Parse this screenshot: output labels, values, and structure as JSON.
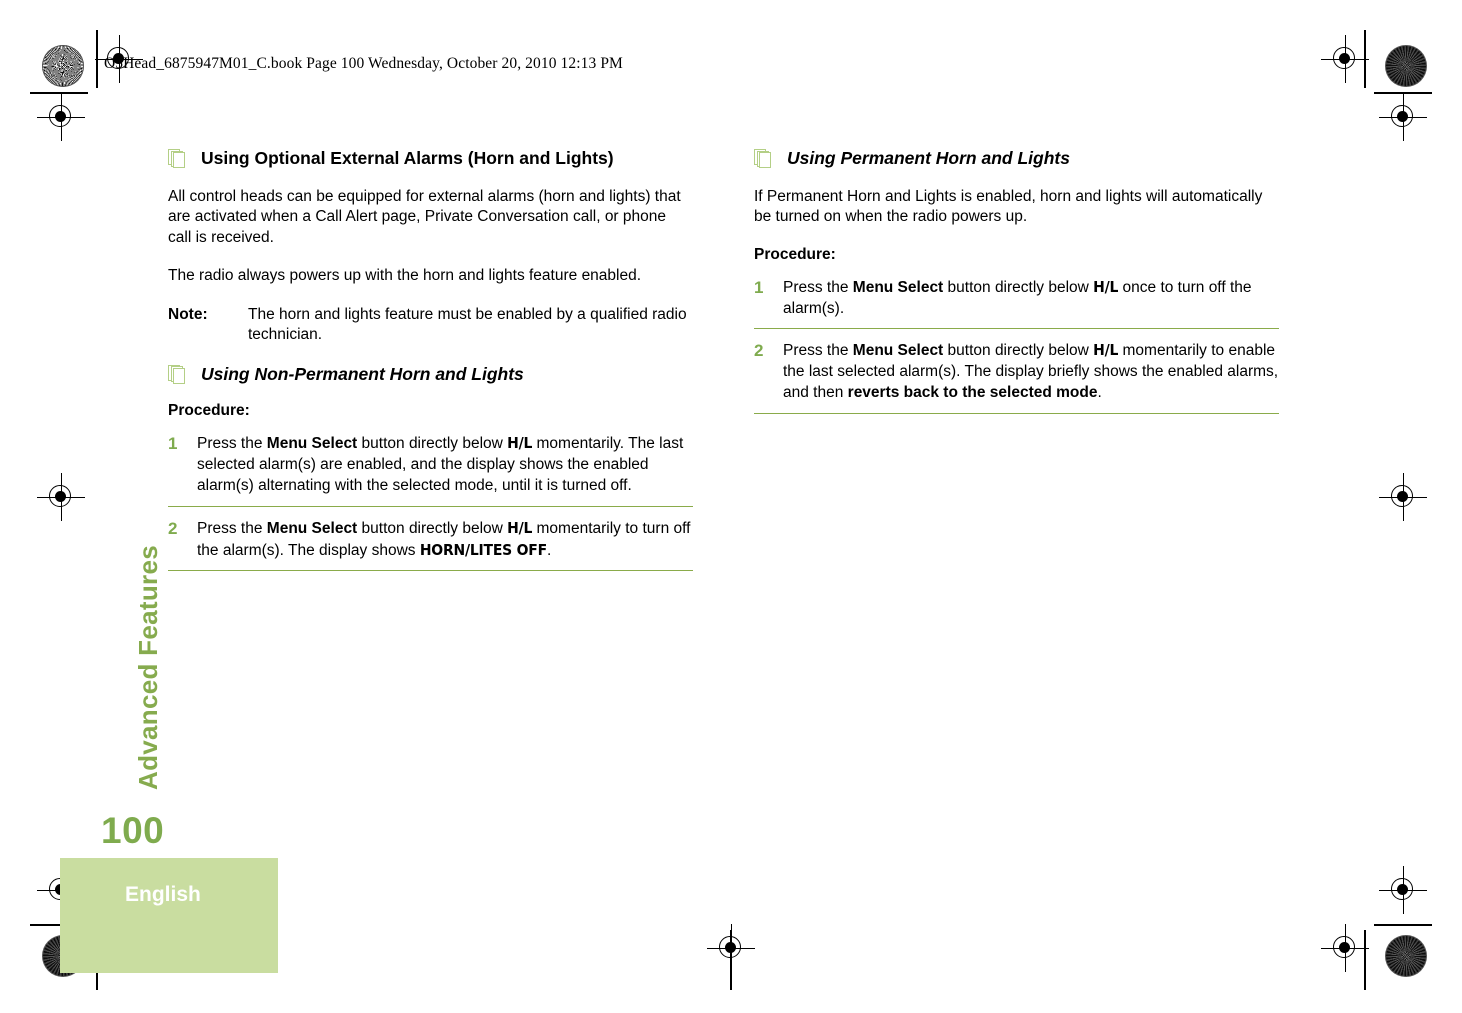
{
  "document": {
    "file_header": "O5Head_6875947M01_C.book  Page 100  Wednesday, October 20, 2010  12:13 PM",
    "side_tab": "Advanced Features",
    "page_number": "100",
    "language": "English"
  },
  "colors": {
    "accent_green": "#7fab4e",
    "rule_green": "#8aab4a",
    "band_green": "#c9dda0",
    "icon_green": "#b4cf86"
  },
  "left_column": {
    "heading": "Using Optional External Alarms (Horn and Lights)",
    "paragraphs": [
      "All control heads can be equipped for external alarms (horn and lights) that are activated when a Call Alert page, Private Conversation call, or phone call is received.",
      "The radio always powers up with the horn and lights feature enabled."
    ],
    "note": {
      "label": "Note:",
      "text": "The horn and lights feature must be enabled by a qualified radio technician."
    },
    "subheading": "Using Non-Permanent Horn and Lights",
    "procedure_label": "Procedure:",
    "steps": [
      {
        "number": "1",
        "part1": "Press the ",
        "bold1": "Menu Select",
        "part2": " button directly below ",
        "display1": "H/L",
        "part3": " momentarily. The last selected alarm(s) are enabled, and the display shows the enabled alarm(s) alternating with the selected mode, until it is turned off."
      },
      {
        "number": "2",
        "part1": "Press the ",
        "bold1": "Menu Select",
        "part2": " button directly below ",
        "display1": "H/L",
        "part3": " momentarily to turn off the alarm(s). The display shows ",
        "display2": "HORN/LITES OFF",
        "part4": "."
      }
    ]
  },
  "right_column": {
    "heading": "Using Permanent Horn and Lights",
    "paragraphs": [
      "If Permanent Horn and Lights is enabled, horn and lights will automatically be turned on when the radio powers up."
    ],
    "procedure_label": "Procedure:",
    "steps": [
      {
        "number": "1",
        "part1": "Press the ",
        "bold1": "Menu Select",
        "part2": " button directly below ",
        "display1": "H/L",
        "part3": " once to turn off the alarm(s)."
      },
      {
        "number": "2",
        "part1": "Press the ",
        "bold1": "Menu Select",
        "part2": " button directly below ",
        "display1": "H/L",
        "part3": " momentarily to enable the last selected alarm(s). The display briefly shows the enabled alarms, and then ",
        "bold2": "reverts back to the selected mode",
        "part4": "."
      }
    ]
  }
}
